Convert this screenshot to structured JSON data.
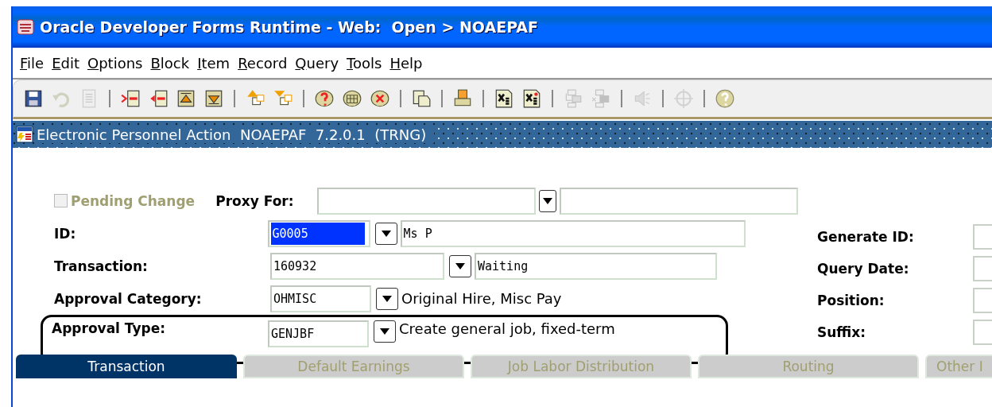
{
  "window": {
    "title": "Oracle Developer Forms Runtime - Web:  Open > NOAEPAF"
  },
  "menu": [
    "File",
    "Edit",
    "Options",
    "Block",
    "Item",
    "Record",
    "Query",
    "Tools",
    "Help"
  ],
  "toolbar": [
    {
      "kind": "save",
      "disabled": false
    },
    {
      "kind": "undo",
      "disabled": true
    },
    {
      "kind": "page",
      "disabled": true
    },
    {
      "kind": "sep"
    },
    {
      "kind": "insert",
      "disabled": false
    },
    {
      "kind": "remove",
      "disabled": false
    },
    {
      "kind": "up",
      "disabled": false
    },
    {
      "kind": "down",
      "disabled": false
    },
    {
      "kind": "sep"
    },
    {
      "kind": "enterquery",
      "disabled": false
    },
    {
      "kind": "execquery",
      "disabled": false
    },
    {
      "kind": "sep"
    },
    {
      "kind": "dbhelp",
      "disabled": false
    },
    {
      "kind": "dbgrid",
      "disabled": false
    },
    {
      "kind": "dbcancel",
      "disabled": false
    },
    {
      "kind": "sep"
    },
    {
      "kind": "copy",
      "disabled": false
    },
    {
      "kind": "sep"
    },
    {
      "kind": "print",
      "disabled": false
    },
    {
      "kind": "sep"
    },
    {
      "kind": "xs",
      "disabled": false
    },
    {
      "kind": "xsdot",
      "disabled": false
    },
    {
      "kind": "sep"
    },
    {
      "kind": "blocks",
      "disabled": true
    },
    {
      "kind": "blocks2",
      "disabled": true
    },
    {
      "kind": "sep"
    },
    {
      "kind": "speaker",
      "disabled": true
    },
    {
      "kind": "sep"
    },
    {
      "kind": "crosshair",
      "disabled": true
    },
    {
      "kind": "sep"
    },
    {
      "kind": "help",
      "disabled": false
    }
  ],
  "form": {
    "title": "Electronic Personnel Action  NOAEPAF  7.2.0.1  (TRNG)"
  },
  "pending_change": {
    "label": "Pending Change",
    "checked": false,
    "disabled": true
  },
  "proxy_for": {
    "label": "Proxy For:"
  },
  "fields": [
    {
      "label": "ID:",
      "code": "G0005",
      "highlighted": true,
      "description": "Ms P",
      "kind": "field"
    },
    {
      "label": "Transaction:",
      "code": "160932",
      "highlighted": false,
      "description": "Waiting",
      "kind": "field"
    },
    {
      "label": "Approval Category:",
      "code": "OHMISC",
      "highlighted": false,
      "description": "Original Hire, Misc Pay",
      "kind": "text"
    },
    {
      "label": "Approval Type:",
      "code": "GENJBF",
      "highlighted": false,
      "description": "Create general job, fixed-term",
      "kind": "text"
    }
  ],
  "right_fields": [
    {
      "label": "Generate ID:"
    },
    {
      "label": "Query Date:"
    },
    {
      "label": "Position:"
    },
    {
      "label": "Suffix:"
    }
  ],
  "tabs": [
    {
      "label": "Transaction",
      "selected": true
    },
    {
      "label": "Default Earnings",
      "selected": false
    },
    {
      "label": "Job Labor Distribution",
      "selected": false
    },
    {
      "label": "Routing",
      "selected": false
    },
    {
      "label": "Other I",
      "selected": false
    }
  ]
}
